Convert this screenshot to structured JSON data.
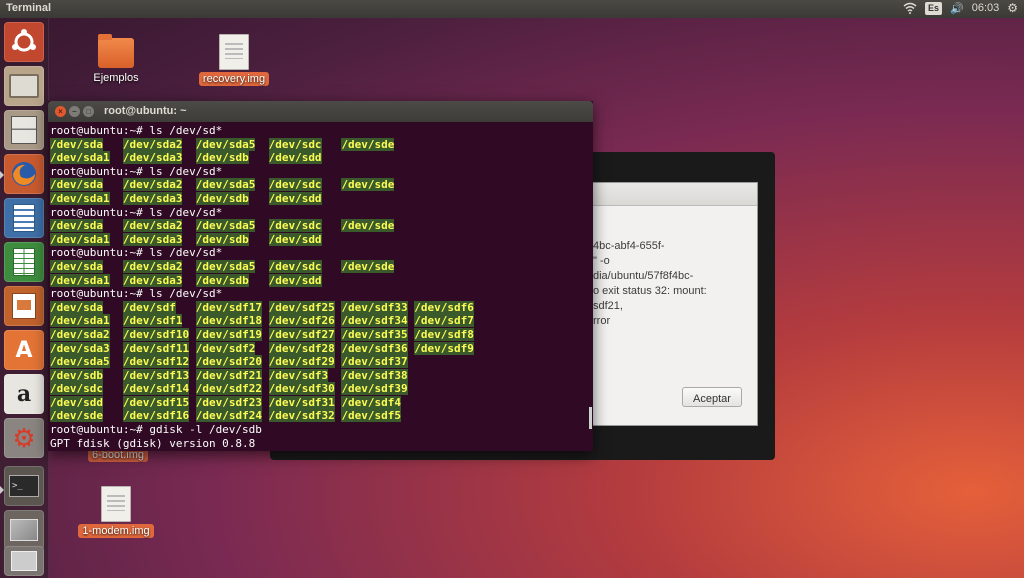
{
  "top_panel": {
    "title": "Terminal",
    "keyboard_layout": "Es",
    "clock": "06:03"
  },
  "launcher": {
    "items": [
      {
        "name": "ubuntu-dash",
        "icon": "ubuntu-logo-icon"
      },
      {
        "name": "install-ubuntu",
        "icon": "installer-icon"
      },
      {
        "name": "files",
        "icon": "file-cabinet-icon"
      },
      {
        "name": "firefox",
        "icon": "firefox-icon"
      },
      {
        "name": "libreoffice-writer",
        "icon": "writer-icon"
      },
      {
        "name": "libreoffice-calc",
        "icon": "calc-icon"
      },
      {
        "name": "libreoffice-impress",
        "icon": "impress-icon"
      },
      {
        "name": "ubuntu-software",
        "icon": "software-center-icon"
      },
      {
        "name": "amazon",
        "icon": "amazon-icon"
      },
      {
        "name": "system-settings",
        "icon": "settings-icon"
      },
      {
        "name": "terminal",
        "icon": "terminal-icon"
      },
      {
        "name": "workspaces",
        "icon": "workspaces-icon"
      },
      {
        "name": "trash",
        "icon": "trash-icon"
      }
    ]
  },
  "desktop": {
    "icons": [
      {
        "label": "Ejemplos",
        "type": "folder"
      },
      {
        "label": "recovery.img",
        "type": "file",
        "selected": true
      },
      {
        "label": "6-boot.img",
        "type": "file",
        "selected": true
      },
      {
        "label": "1-modem.img",
        "type": "file",
        "selected": true
      }
    ]
  },
  "dialog": {
    "lines": "4bc-abf4-655f-\n\" -o\ndia/ubuntu/57f8f4bc-\no exit status 32: mount:\nsdf21,\nrror",
    "accept_label": "Aceptar"
  },
  "terminal": {
    "title": "root@ubuntu: ~",
    "prompt": "root@ubuntu:~# ",
    "ls_cmd": "ls /dev/sd*",
    "short_listing": [
      [
        "/dev/sda",
        "/dev/sda2",
        "/dev/sda5",
        "/dev/sdc",
        "/dev/sde"
      ],
      [
        "/dev/sda1",
        "/dev/sda3",
        "/dev/sdb",
        "/dev/sdd"
      ]
    ],
    "long_listing": [
      [
        "/dev/sda",
        "/dev/sdf",
        "/dev/sdf17",
        "/dev/sdf25",
        "/dev/sdf33",
        "/dev/sdf6"
      ],
      [
        "/dev/sda1",
        "/dev/sdf1",
        "/dev/sdf18",
        "/dev/sdf26",
        "/dev/sdf34",
        "/dev/sdf7"
      ],
      [
        "/dev/sda2",
        "/dev/sdf10",
        "/dev/sdf19",
        "/dev/sdf27",
        "/dev/sdf35",
        "/dev/sdf8"
      ],
      [
        "/dev/sda3",
        "/dev/sdf11",
        "/dev/sdf2",
        "/dev/sdf28",
        "/dev/sdf36",
        "/dev/sdf9"
      ],
      [
        "/dev/sda5",
        "/dev/sdf12",
        "/dev/sdf20",
        "/dev/sdf29",
        "/dev/sdf37"
      ],
      [
        "/dev/sdb",
        "/dev/sdf13",
        "/dev/sdf21",
        "/dev/sdf3",
        "/dev/sdf38"
      ],
      [
        "/dev/sdc",
        "/dev/sdf14",
        "/dev/sdf22",
        "/dev/sdf30",
        "/dev/sdf39"
      ],
      [
        "/dev/sdd",
        "/dev/sdf15",
        "/dev/sdf23",
        "/dev/sdf31",
        "/dev/sdf4"
      ],
      [
        "/dev/sde",
        "/dev/sdf16",
        "/dev/sdf24",
        "/dev/sdf32",
        "/dev/sdf5"
      ]
    ],
    "gdisk_cmd": "gdisk -l /dev/sdb",
    "gdisk_output": "GPT fdisk (gdisk) version 0.8.8"
  }
}
